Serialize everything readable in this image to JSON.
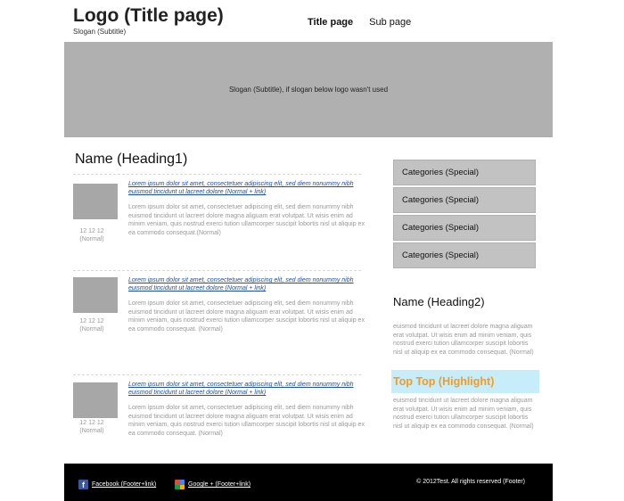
{
  "header": {
    "logo_title": "Logo (Title page)",
    "logo_subtitle": "Slogan (Subtitle)"
  },
  "nav": {
    "items": [
      "Title page",
      "Sub page"
    ]
  },
  "banner": {
    "text": "Slogan (Subtitle), if slogan below logo wasn't used"
  },
  "main": {
    "heading": "Name (Heading1)",
    "articles": [
      {
        "link": "Lorem ipsum dolor sit amet, consectetuer adipiscing elit, sed diem nonummy nibh euismod tincidunt ut lacreet dolore (Normal + link)",
        "body": "Lorem ipsum dolor sit amet, consectetuer adipiscing elit, sed diem nonummy nibh euismod tincidunt ut lacreet dolore magna aliguam erat volutpat. Ut wisis enim ad minim veniam, quis nostrud exerci tution ullamcorper suscipit lobortis nisl ut aliquip ex ea commodo consequat.(Normal)",
        "date": "12 12 12",
        "date_style": "(Normal)"
      },
      {
        "link": "Lorem ipsum dolor sit amet, consectetuer adipiscing elit, sed diem nonummy nibh euismod tincidunt ut lacreet dolore (Normal + link)",
        "body": "Lorem ipsum dolor sit amet, consectetuer adipiscing elit, sed diem nonummy nibh euismod tincidunt ut lacreet dolore magna aliguam erat volutpat. Ut wisis enim ad minim veniam, quis nostrud exerci tution ullamcorper suscipit lobortis nisl ut aliquip ex ea commodo consequat. (Normal)",
        "date": "12 12 12",
        "date_style": "(Normal)"
      },
      {
        "link": "Lorem ipsum dolor sit amet, consectetuer adipiscing elit, sed diem nonummy nibh euismod tincidunt ut lacreet dolore (Normal + link)",
        "body": "Lorem ipsum dolor sit amet, consectetuer adipiscing elit, sed diem nonummy nibh euismod tincidunt ut lacreet dolore magna aliguam erat volutpat. Ut wisis enim ad minim veniam, quis nostrud exerci tution ullamcorper suscipit lobortis nisl ut aliquip ex ea commodo consequat. (Normal)",
        "date": "12 12 12",
        "date_style": "(Normal)"
      }
    ]
  },
  "sidebar": {
    "categories": [
      "Categories (Special)",
      "Categories (Special)",
      "Categories (Special)",
      "Categories (Special)"
    ],
    "heading2": "Name (Heading2)",
    "text1": "euismod tincidunt ut lacreet dolore magna aliguam erat volutpat. Ut wisis enim ad minim veniam, quis nostrud exerci tution ullamcorper suscipit lobortis nisl ut aliquip ex ea commodo consequat. (Normal)",
    "highlight": "Top Top (Highlight)",
    "text2": "euismod tincidunt ut lacreet dolore magna aliguam erat volutpat. Ut wisis enim ad minim veniam, quis nostrud exerci tution ullamcorper suscipit lobortis nisl ut aliquip ex ea commodo consequat. (Normal)"
  },
  "footer": {
    "facebook": "Facebook (Footer+link)",
    "google": "Google + (Footer+link)",
    "copyright": "© 2012Test.  All rights reserved (Footer)"
  },
  "colors": {
    "banner": "#b0b0b0",
    "link": "#1f4fa5",
    "highlight_bg": "#c7ecfa",
    "highlight_text": "#f39c21",
    "footer_bg": "#000000"
  },
  "icons": [
    "facebook-icon",
    "google-plus-icon"
  ]
}
